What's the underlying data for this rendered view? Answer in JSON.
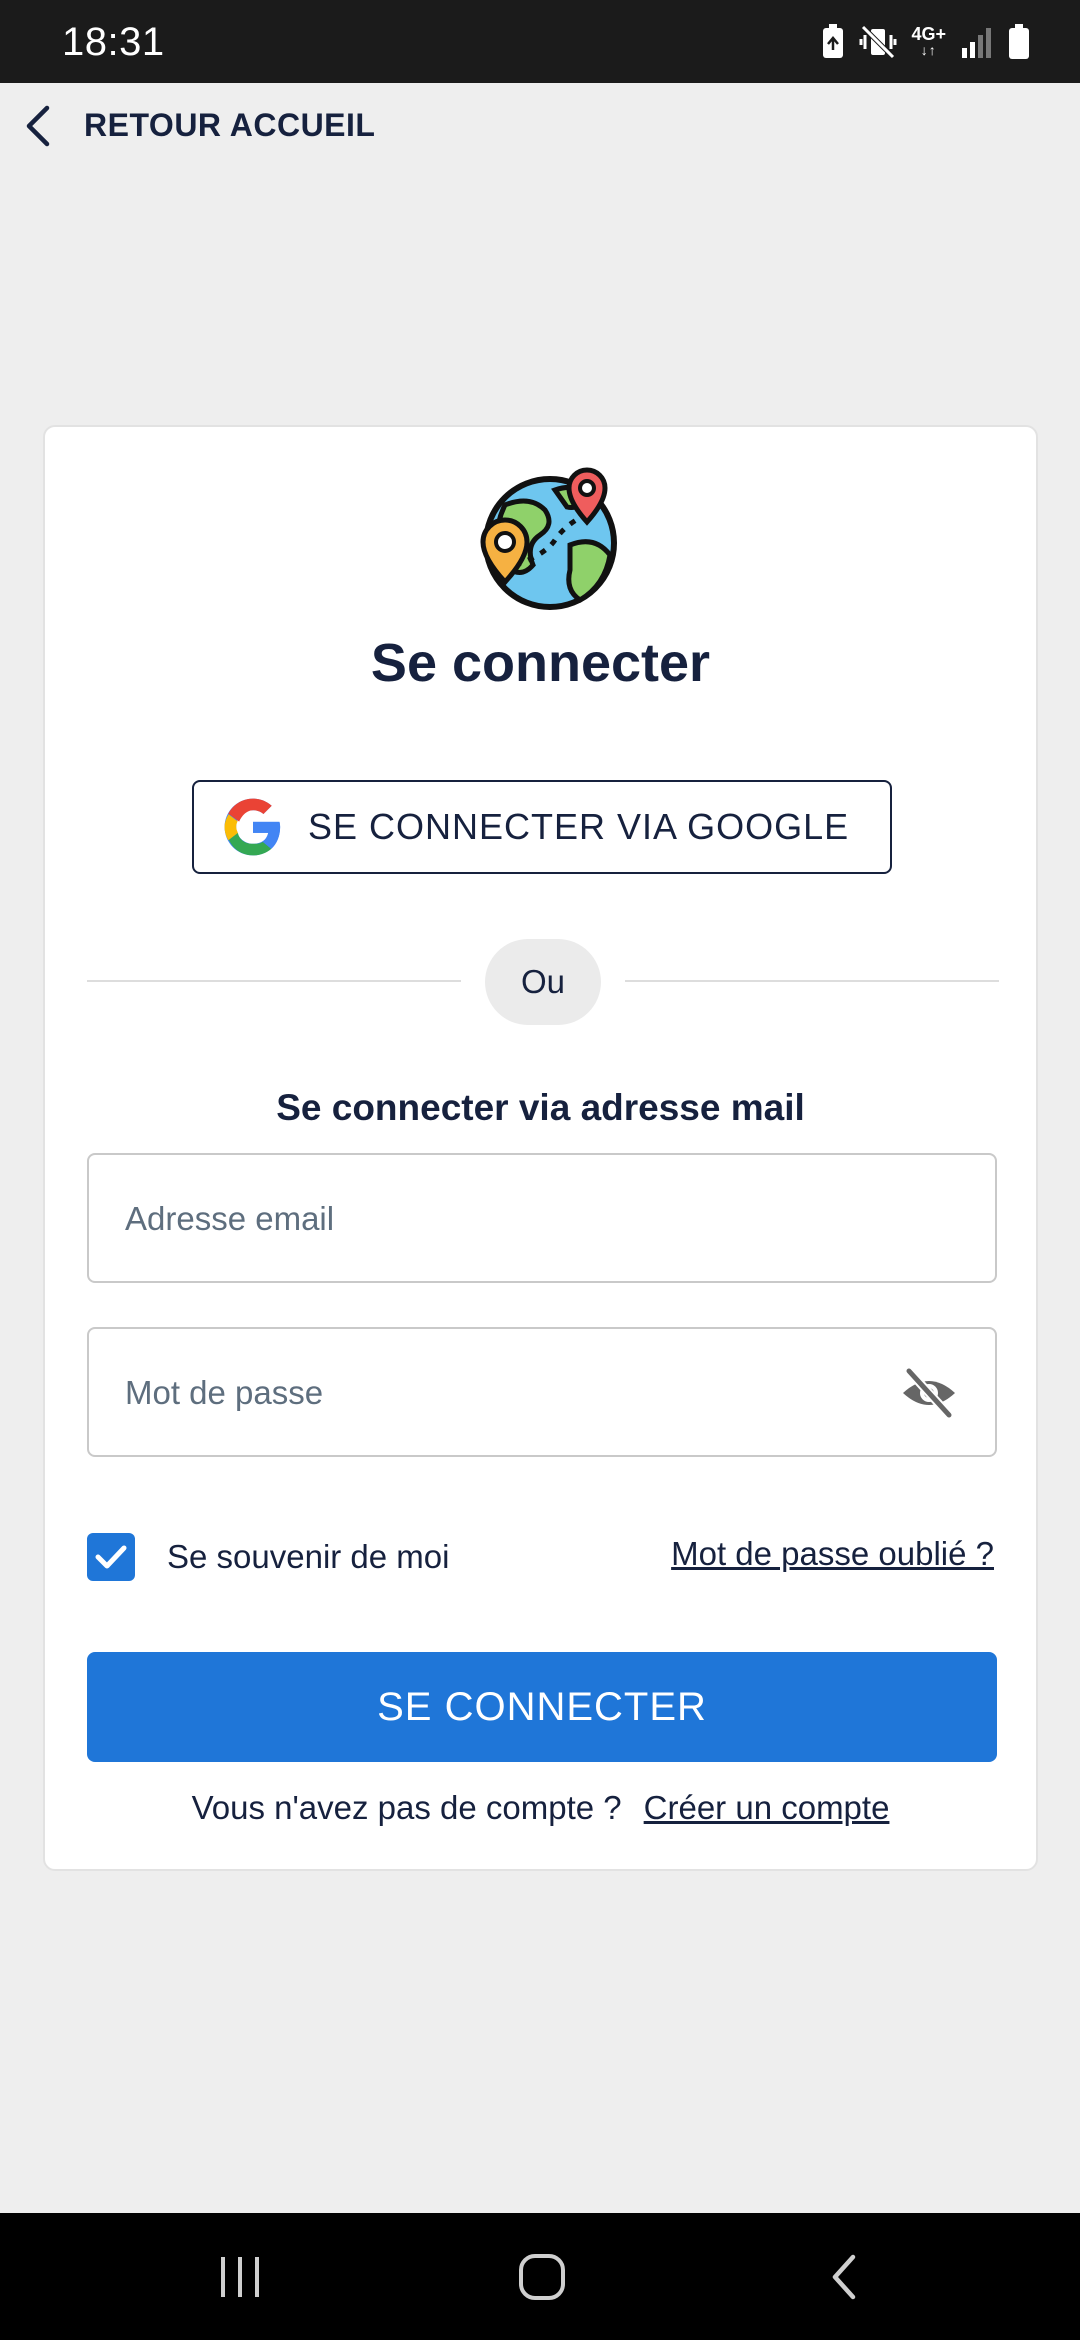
{
  "status_bar": {
    "time": "18:31",
    "network_type": "4G+",
    "icons": [
      "battery-saver-icon",
      "vibrate-mute-icon",
      "network-4g-icon",
      "signal-icon",
      "battery-icon"
    ]
  },
  "nav": {
    "back_label": "RETOUR ACCUEIL",
    "back_icon": "chevron-left-icon"
  },
  "login": {
    "logo_icon": "globe-pins-icon",
    "title": "Se connecter",
    "google_button": "SE CONNECTER VIA GOOGLE",
    "divider": "Ou",
    "email_section_title": "Se connecter via adresse mail",
    "email_placeholder": "Adresse email",
    "password_placeholder": "Mot de passe",
    "password_toggle_icon": "eye-off-icon",
    "remember_me": "Se souvenir de moi",
    "remember_checked": true,
    "forgot_password": "Mot de passe oublié ?",
    "submit_button": "SE CONNECTER",
    "no_account_text": "Vous n'avez pas de compte ?",
    "create_account": "Créer un compte"
  },
  "colors": {
    "primary": "#1f76d8",
    "text_dark": "#16213e",
    "background": "#eeeeee"
  },
  "system_nav": {
    "icons": [
      "recents-icon",
      "home-icon",
      "back-icon"
    ]
  }
}
